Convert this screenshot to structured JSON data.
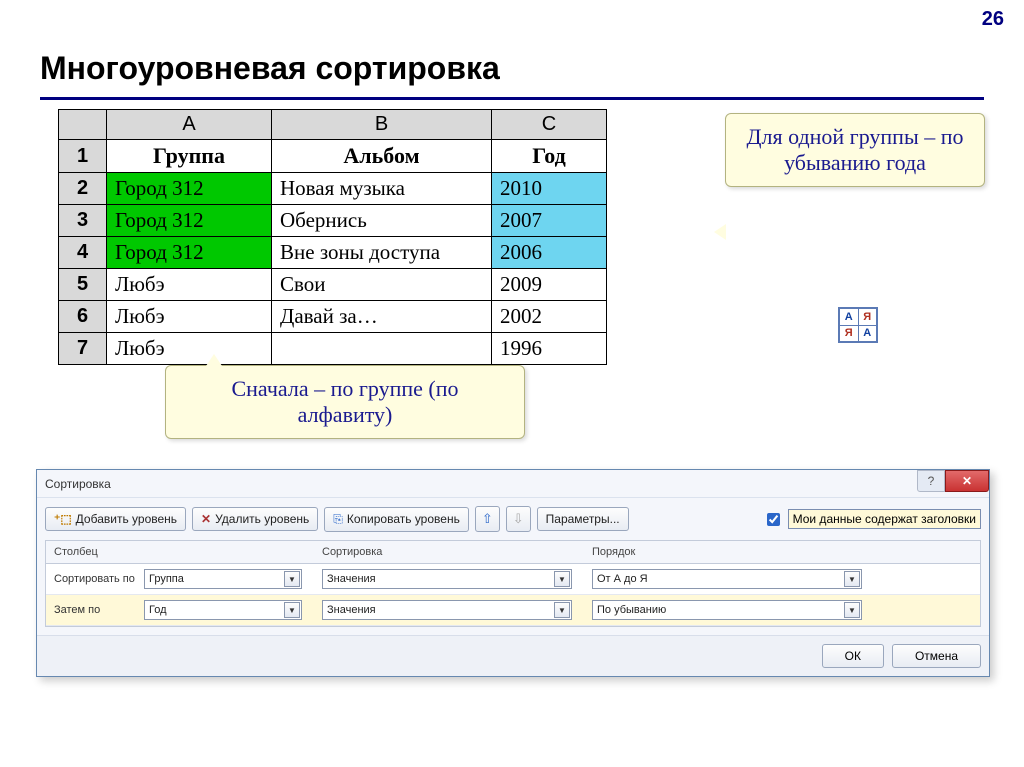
{
  "page_number": "26",
  "title": "Многоуровневая сортировка",
  "sheet": {
    "cols": [
      "A",
      "B",
      "C"
    ],
    "header_row": {
      "A": "Группа",
      "B": "Альбом",
      "C": "Год"
    },
    "rows": [
      {
        "n": "2",
        "A": "Город 312",
        "B": "Новая музыка",
        "C": "2010",
        "hl": "yes"
      },
      {
        "n": "3",
        "A": "Город 312",
        "B": "Обернись",
        "C": "2007",
        "hl": "yes"
      },
      {
        "n": "4",
        "A": "Город 312",
        "B": "Вне зоны доступа",
        "C": "2006",
        "hl": "yes"
      },
      {
        "n": "5",
        "A": "Любэ",
        "B": "Свои",
        "C": "2009",
        "hl": "no"
      },
      {
        "n": "6",
        "A": "Любэ",
        "B": "Давай за…",
        "C": "2002",
        "hl": "no"
      },
      {
        "n": "7",
        "A": "Любэ",
        "B": "",
        "C": "1996",
        "hl": "no"
      }
    ]
  },
  "callout1": "Для одной группы – по убыванию года",
  "callout2": "Сначала – по группе (по алфавиту)",
  "sort_glyphs": {
    "a": "А",
    "ya": "Я"
  },
  "dialog": {
    "title": "Сортировка",
    "buttons": {
      "add": "Добавить уровень",
      "del": "Удалить уровень",
      "copy": "Копировать уровень",
      "params": "Параметры..."
    },
    "checkbox": "Мои данные содержат заголовки",
    "headers": {
      "col": "Столбец",
      "sort": "Сортировка",
      "order": "Порядок"
    },
    "rows": [
      {
        "label": "Сортировать по",
        "col": "Группа",
        "sort": "Значения",
        "order": "От А до Я"
      },
      {
        "label": "Затем по",
        "col": "Год",
        "sort": "Значения",
        "order": "По убыванию"
      }
    ],
    "footer": {
      "ok": "ОК",
      "cancel": "Отмена"
    }
  }
}
